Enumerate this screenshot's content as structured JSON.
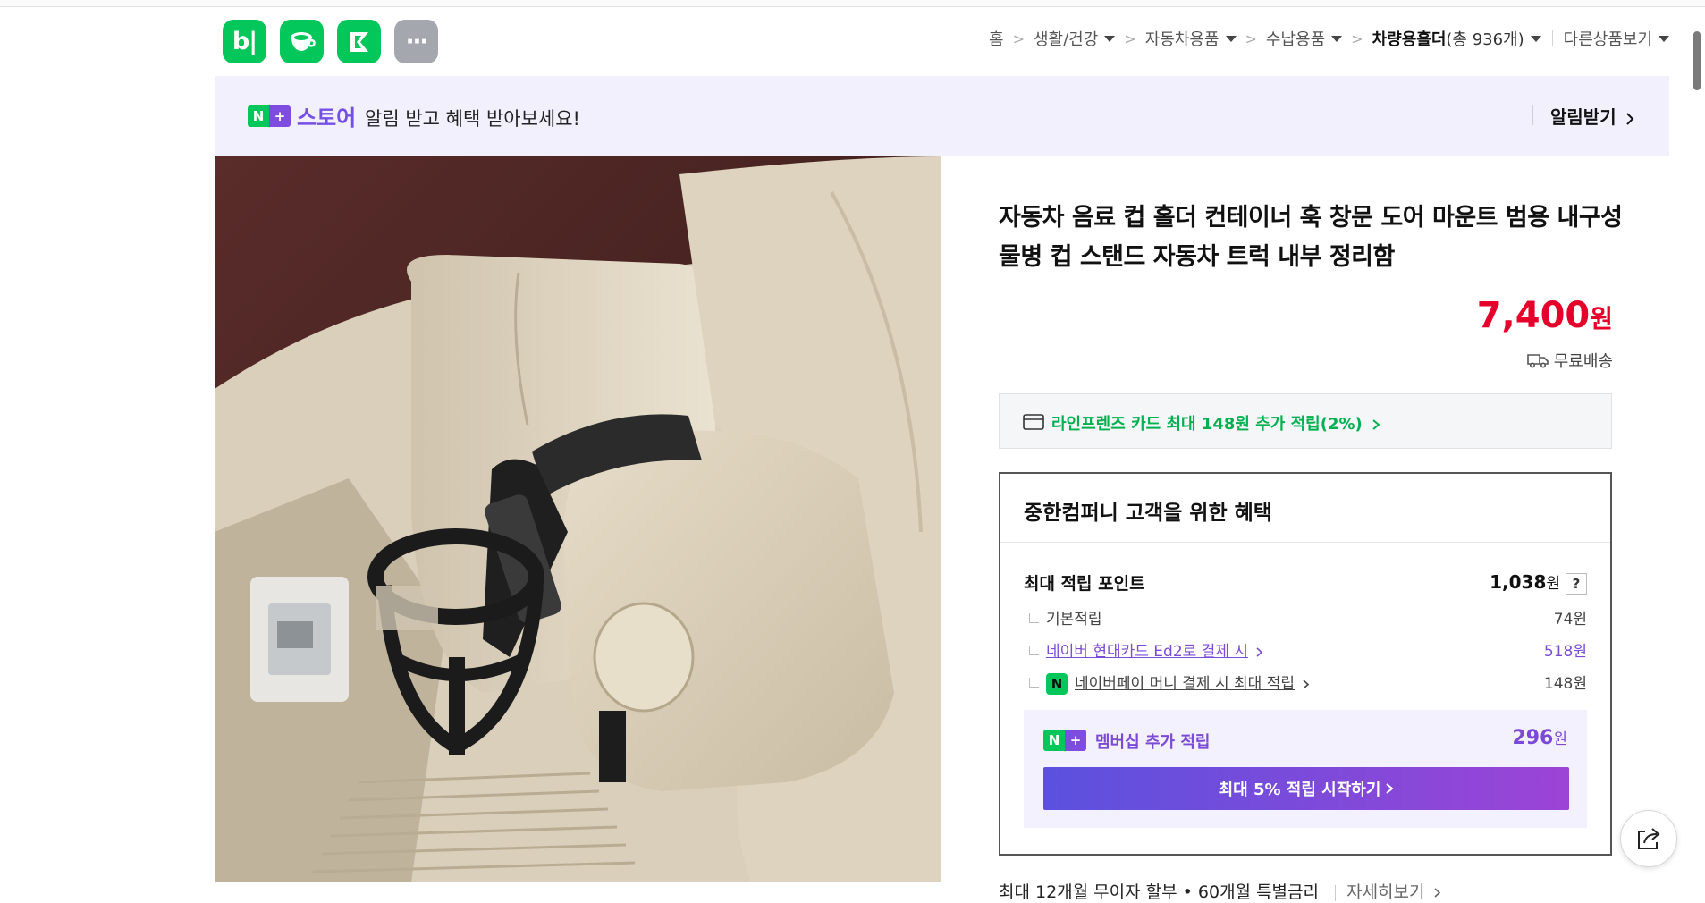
{
  "app_icons": [
    {
      "name": "blog",
      "label": "b|"
    },
    {
      "name": "cafe",
      "label": ""
    },
    {
      "name": "kidsnote",
      "label": ""
    },
    {
      "name": "more",
      "label": "···"
    }
  ],
  "breadcrumb": {
    "home": "홈",
    "cat1": "생활/건강",
    "cat2": "자동차용품",
    "cat3": "수납용품",
    "cat4": "차량용홀더",
    "cat4_count": "(총 936개)",
    "other": "다른상품보기",
    "separator": ">"
  },
  "banner": {
    "n_label": "N",
    "plus_label": "+",
    "store_word": "스토어",
    "message": "알림 받고 혜택 받아보세요!",
    "alarm_button": "알림받기"
  },
  "product": {
    "title": "자동차 음료 컵 홀더 컨테이너 훅 창문 도어 마운트 범용 내구성 물병 컵 스탠드 자동차 트럭 내부 정리함",
    "price": "7,400",
    "price_unit": "원",
    "shipping": "무료배송",
    "card_benefit": "라인프렌즈 카드 최대 148원 추가 적립(2%)"
  },
  "benefits": {
    "heading": "중한컴퍼니 고객을 위한 혜택",
    "max_points_label": "최대 적립 포인트",
    "max_points_value": "1,038",
    "won": "원",
    "help": "?",
    "basic_label": "기본적립",
    "basic_value": "74원",
    "hyundai_label": "네이버 현대카드 Ed2로 결제 시",
    "hyundai_value": "518원",
    "npay_icon": "N",
    "npay_label": "네이버페이 머니 결제 시 최대 적립",
    "npay_value": "148원",
    "membership_label": "멤버십 추가 적립",
    "membership_value": "296",
    "membership_button": "최대 5% 적립 시작하기"
  },
  "installment": {
    "text": "최대 12개월 무이자 할부 • 60개월 특별금리",
    "more": "자세히보기"
  },
  "colors": {
    "naver_green": "#03c75a",
    "plus_purple": "#7f4ce0",
    "price_red": "#e5002b",
    "card_green": "#00b050"
  }
}
